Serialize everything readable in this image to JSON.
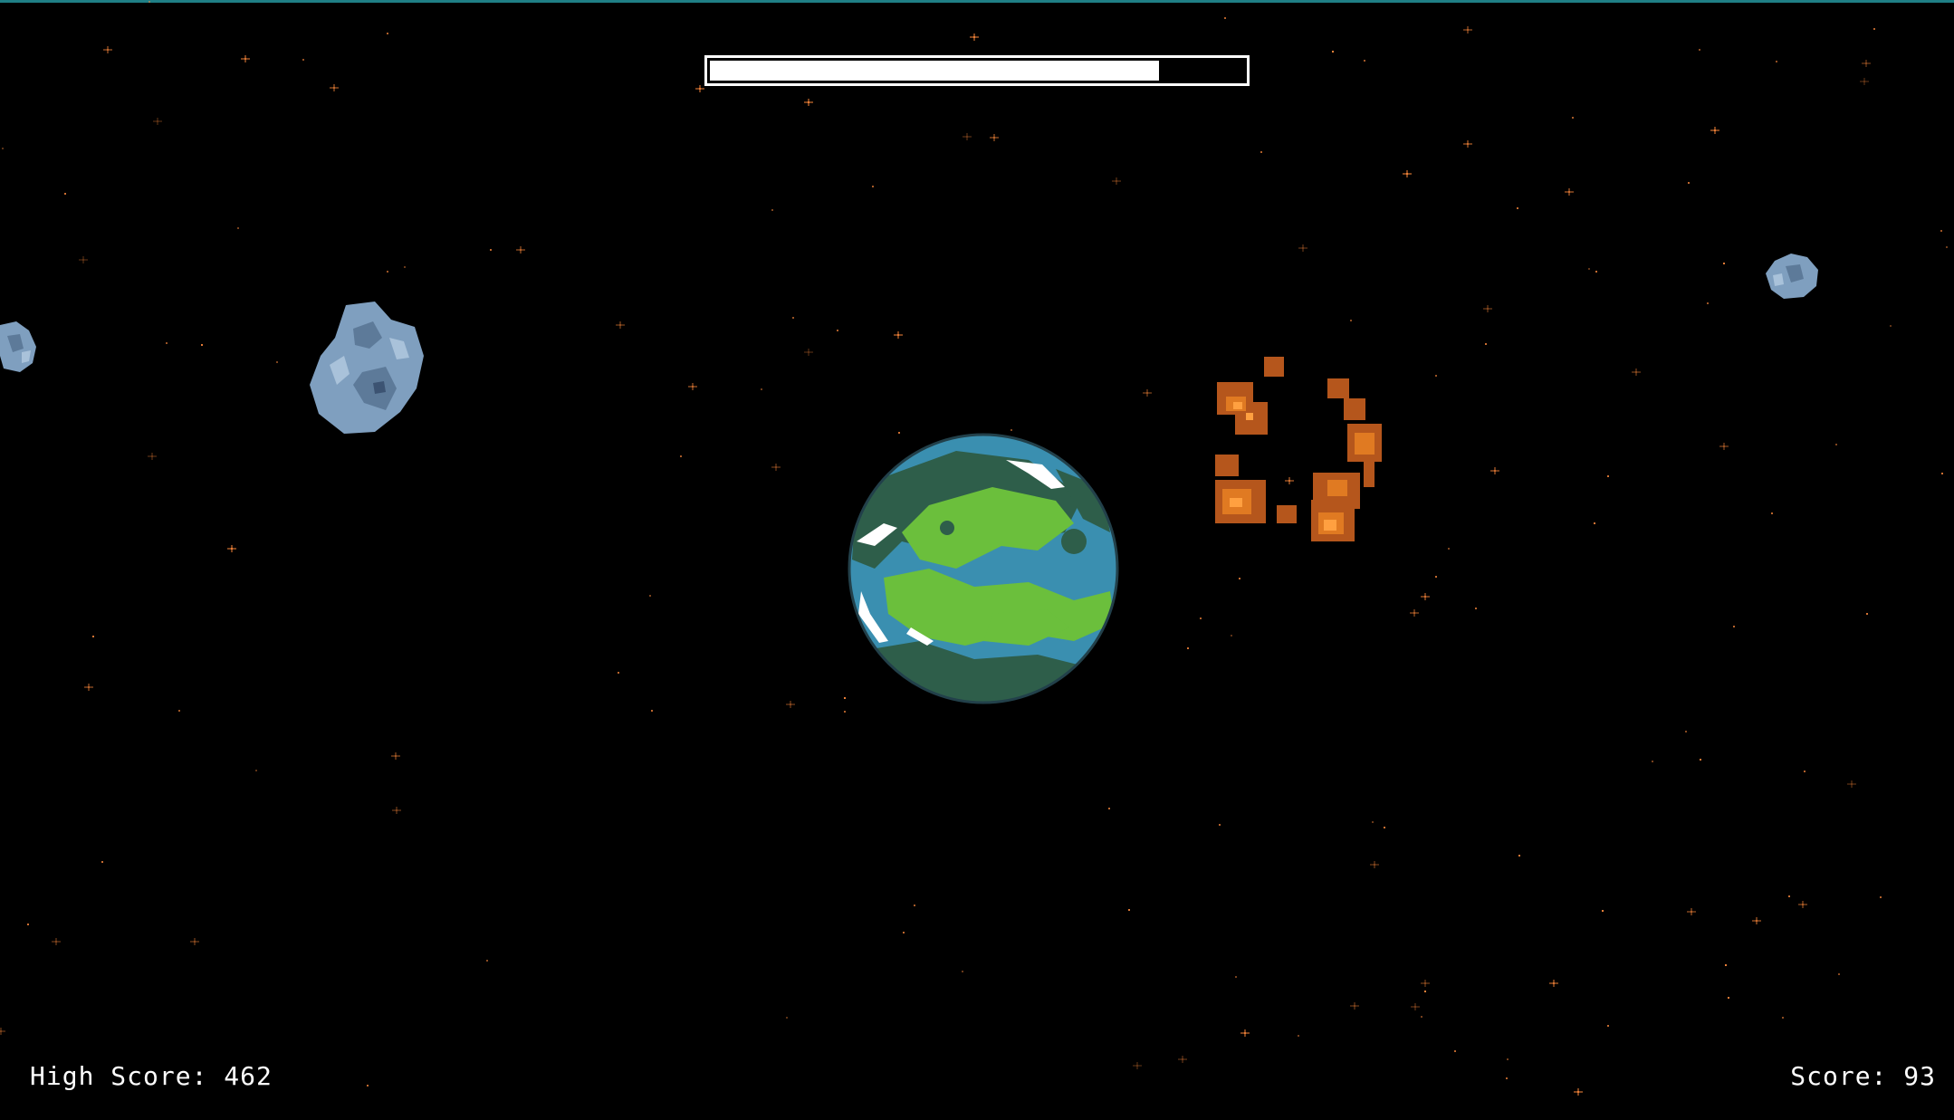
{
  "hud": {
    "high_score_label": "High Score:",
    "high_score_value": "462",
    "score_label": "Score:",
    "score_value": "93",
    "text_color": "#ffffff"
  },
  "health_bar": {
    "fill_fraction": 0.84,
    "fill_color": "#ffffff",
    "border_color": "#ffffff"
  },
  "scene": {
    "background_color": "#000000",
    "star_color": "#ff8a3d",
    "planet": {
      "icon": "earth-planet-icon",
      "ocean_color": "#3a8fb0",
      "land_color": "#6bbf3c",
      "dark_land_color": "#2e5e4a",
      "cloud_color": "#ffffff"
    },
    "asteroids": [
      {
        "icon": "asteroid-large-icon",
        "color": "#7f9fbf"
      },
      {
        "icon": "asteroid-small-icon",
        "color": "#7f9fbf"
      },
      {
        "icon": "asteroid-small-icon",
        "color": "#7f9fbf"
      }
    ],
    "explosion": {
      "icon": "explosion-icon",
      "colors": [
        "#b5561c",
        "#e07a22",
        "#ffa040"
      ]
    }
  }
}
